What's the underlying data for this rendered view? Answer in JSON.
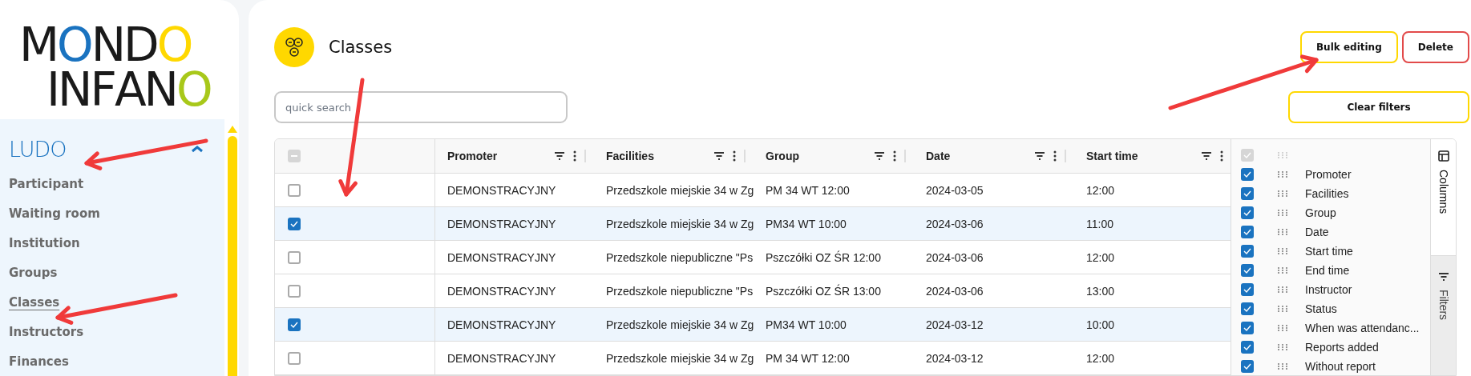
{
  "logo": {
    "lines": [
      "MONDO",
      "INFANO"
    ]
  },
  "sidebar": {
    "section": {
      "title": "LUDO",
      "expanded": true
    },
    "items": [
      {
        "label": "Participant",
        "selected": false
      },
      {
        "label": "Waiting room",
        "selected": false
      },
      {
        "label": "Institution",
        "selected": false
      },
      {
        "label": "Groups",
        "selected": false
      },
      {
        "label": "Classes",
        "selected": true
      },
      {
        "label": "Instructors",
        "selected": false
      },
      {
        "label": "Finances",
        "selected": false
      }
    ]
  },
  "page": {
    "title": "Classes"
  },
  "search": {
    "placeholder": "quick search"
  },
  "buttons": [
    {
      "label": "Bulk editing",
      "kind": "warning"
    },
    {
      "label": "Delete",
      "kind": "danger"
    }
  ],
  "clear_filters": {
    "label": "Clear filters",
    "kind": "warning"
  },
  "table": {
    "select_all_partial": true,
    "columns": [
      "Promoter",
      "Facilities",
      "Group",
      "Date",
      "Start time"
    ],
    "rows": [
      {
        "selected": false,
        "cells": [
          "DEMONSTRACYJNY",
          "Przedszkole miejskie 34 w Zg",
          "PM 34 WT 12:00",
          "2024-03-05",
          "12:00"
        ]
      },
      {
        "selected": true,
        "cells": [
          "DEMONSTRACYJNY",
          "Przedszkole miejskie 34 w Zg",
          "PM34 WT 10:00",
          "2024-03-06",
          "11:00"
        ]
      },
      {
        "selected": false,
        "cells": [
          "DEMONSTRACYJNY",
          "Przedszkole niepubliczne \"Ps",
          "Pszczółki OZ ŚR 12:00",
          "2024-03-06",
          "12:00"
        ]
      },
      {
        "selected": false,
        "cells": [
          "DEMONSTRACYJNY",
          "Przedszkole niepubliczne \"Ps",
          "Pszczółki OZ ŚR 13:00",
          "2024-03-06",
          "13:00"
        ]
      },
      {
        "selected": true,
        "cells": [
          "DEMONSTRACYJNY",
          "Przedszkole miejskie 34 w Zg",
          "PM34 WT 10:00",
          "2024-03-12",
          "10:00"
        ]
      },
      {
        "selected": false,
        "cells": [
          "DEMONSTRACYJNY",
          "Przedszkole miejskie 34 w Zg",
          "PM 34 WT 12:00",
          "2024-03-12",
          "12:00"
        ]
      }
    ]
  },
  "column_panel": {
    "all_checked": true,
    "all_disabled": true,
    "items": [
      {
        "label": "Promoter",
        "checked": true
      },
      {
        "label": "Facilities",
        "checked": true
      },
      {
        "label": "Group",
        "checked": true
      },
      {
        "label": "Date",
        "checked": true
      },
      {
        "label": "Start time",
        "checked": true
      },
      {
        "label": "End time",
        "checked": true
      },
      {
        "label": "Instructor",
        "checked": true
      },
      {
        "label": "Status",
        "checked": true
      },
      {
        "label": "When was attendanc...",
        "checked": true
      },
      {
        "label": "Reports added",
        "checked": true
      },
      {
        "label": "Without report",
        "checked": true
      }
    ]
  },
  "side_tabs": [
    {
      "label": "Columns",
      "kind": "columns",
      "selected": true
    },
    {
      "label": "Filters",
      "kind": "filters",
      "selected": false
    }
  ],
  "annotations": [
    {
      "kind": "arrow"
    },
    {
      "kind": "arrow"
    },
    {
      "kind": "arrow"
    },
    {
      "kind": "arrow"
    }
  ]
}
